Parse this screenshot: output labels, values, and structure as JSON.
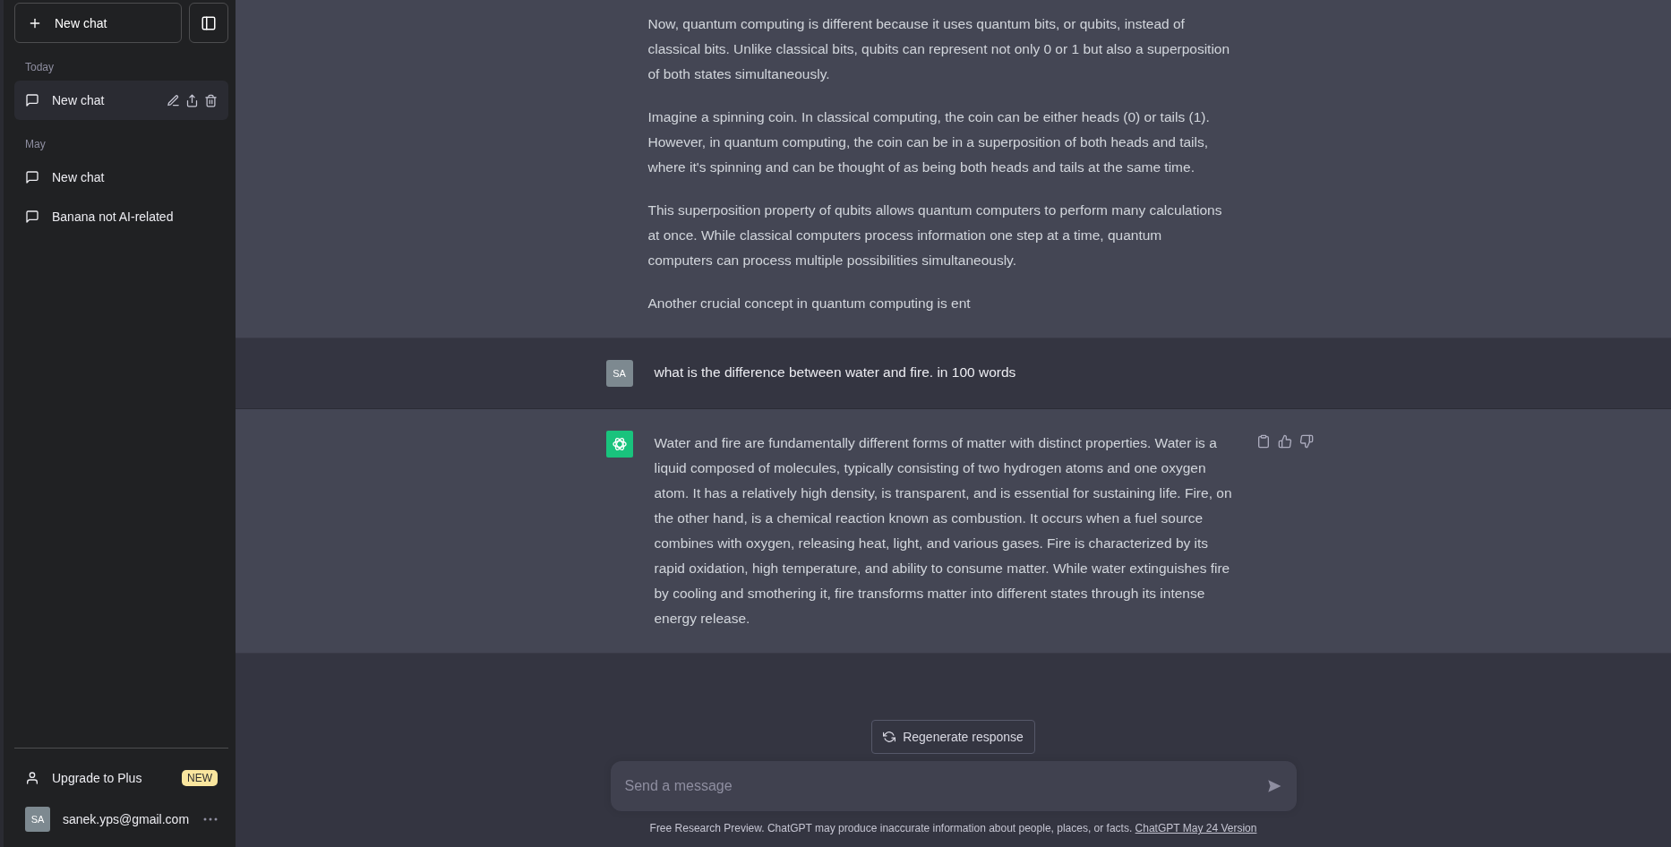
{
  "sidebar": {
    "new_chat_button": "New chat",
    "sections": [
      {
        "label": "Today",
        "items": [
          {
            "title": "New chat",
            "selected": true
          }
        ]
      },
      {
        "label": "May",
        "items": [
          {
            "title": "New chat",
            "selected": false
          },
          {
            "title": "Banana not AI-related",
            "selected": false
          }
        ]
      }
    ],
    "upgrade": {
      "label": "Upgrade to Plus",
      "badge": "NEW"
    },
    "account": {
      "initials": "SA",
      "email": "sanek.yps@gmail.com"
    }
  },
  "messages": [
    {
      "kind": "assistant",
      "avatar_visible": false,
      "paragraphs": [
        "Now, quantum computing is different because it uses quantum bits, or qubits, instead of classical bits. Unlike classical bits, qubits can represent not only 0 or 1 but also a superposition of both states simultaneously.",
        "Imagine a spinning coin. In classical computing, the coin can be either heads (0) or tails (1). However, in quantum computing, the coin can be in a superposition of both heads and tails, where it's spinning and can be thought of as being both heads and tails at the same time.",
        "This superposition property of qubits allows quantum computers to perform many calculations at once. While classical computers process information one step at a time, quantum computers can process multiple possibilities simultaneously.",
        "Another crucial concept in quantum computing is ent"
      ]
    },
    {
      "kind": "user",
      "avatar_visible": true,
      "initials": "SA",
      "paragraphs": [
        "what is the difference between water and fire. in 100 words"
      ]
    },
    {
      "kind": "assistant",
      "avatar_visible": true,
      "paragraphs": [
        "Water and fire are fundamentally different forms of matter with distinct properties. Water is a liquid composed of molecules, typically consisting of two hydrogen atoms and one oxygen atom. It has a relatively high density, is transparent, and is essential for sustaining life. Fire, on the other hand, is a chemical reaction known as combustion. It occurs when a fuel source combines with oxygen, releasing heat, light, and various gases. Fire is characterized by its rapid oxidation, high temperature, and ability to consume matter. While water extinguishes fire by cooling and smothering it, fire transforms matter into different states through its intense energy release."
      ]
    }
  ],
  "regenerate_button": "Regenerate response",
  "composer": {
    "placeholder": "Send a message"
  },
  "footer": {
    "text": "Free Research Preview. ChatGPT may produce inaccurate information about people, places, or facts.",
    "link": "ChatGPT May 24 Version"
  }
}
